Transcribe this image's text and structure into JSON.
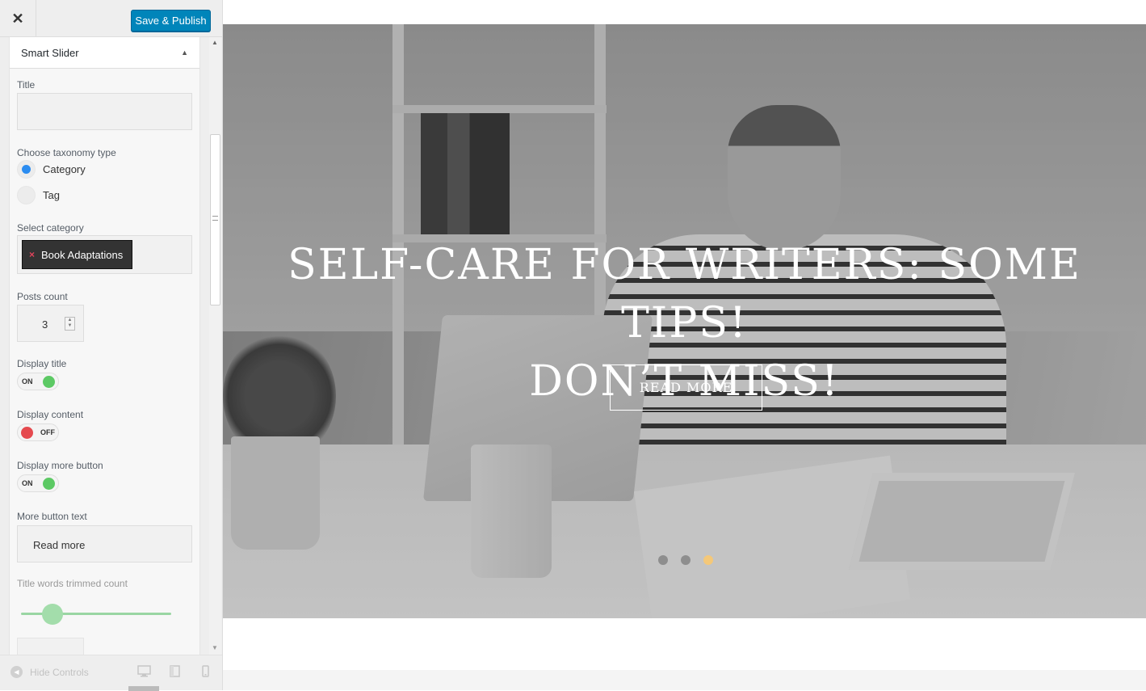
{
  "topbar": {
    "close_glyph": "✕",
    "publish_label": "Save & Publish"
  },
  "section": {
    "title": "Smart Slider",
    "toggle_glyph": "▲"
  },
  "fields": {
    "title_label": "Title",
    "title_value": "",
    "taxonomy_label": "Choose taxonomy type",
    "taxonomy_options": [
      {
        "label": "Category",
        "selected": true
      },
      {
        "label": "Tag",
        "selected": false
      }
    ],
    "category_label": "Select category",
    "category_selected": "Book Adaptations",
    "category_remove_glyph": "×",
    "posts_count_label": "Posts count",
    "posts_count_value": "3",
    "display_title_label": "Display title",
    "display_title_state": "ON",
    "display_content_label": "Display content",
    "display_content_state": "OFF",
    "display_more_label": "Display more button",
    "display_more_state": "ON",
    "more_text_label": "More button text",
    "more_text_value": "Read more",
    "trim_label": "Title words trimmed count",
    "trim_slider_fraction": 0.13
  },
  "footer": {
    "hide_label": "Hide Controls",
    "devices": [
      "desktop-icon",
      "tablet-icon",
      "mobile-icon"
    ]
  },
  "preview": {
    "hero_title_line1": "SELF-CARE FOR WRITERS: SOME TIPS!",
    "hero_title_line2": "DON’T MISS!",
    "read_more_label": "READ MORE",
    "slides_total": 3,
    "active_slide": 3
  },
  "colors": {
    "publish_button": "#0085ba",
    "radio_selected": "#2b8cf0",
    "toggle_on": "#5cc964",
    "toggle_off": "#e5494e",
    "slider_active": "#f4c879",
    "range_track": "#9ad6a3"
  }
}
